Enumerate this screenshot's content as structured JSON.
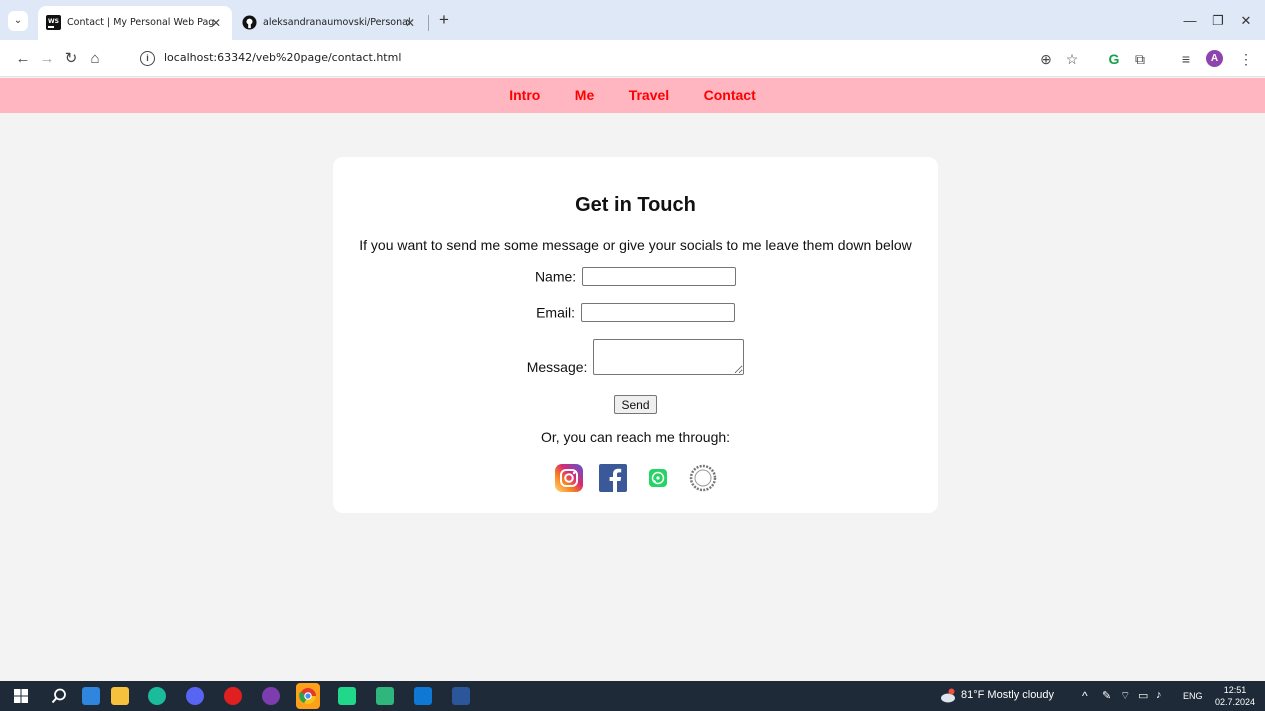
{
  "browser": {
    "tabs": [
      {
        "title": "Contact | My Personal Web Pag",
        "active": true
      },
      {
        "title": "aleksandranaumovski/Personal",
        "active": false
      }
    ],
    "tab_close": "✕",
    "new_tab": "+",
    "url": "localhost:63342/veb%20page/contact.html",
    "window_controls": {
      "minimize": "—",
      "restore": "❐",
      "close": "✕"
    },
    "profile_initial": "A"
  },
  "site_nav": {
    "items": [
      "Intro",
      "Me",
      "Travel",
      "Contact"
    ],
    "link_color": "#ff0000",
    "background": "#ffb6c1"
  },
  "contact": {
    "heading": "Get in Touch",
    "intro": "If you want to send me some message or give your socials to me leave them down below",
    "name_label": "Name:",
    "email_label": "Email:",
    "message_label": "Message:",
    "name_value": "",
    "email_value": "",
    "message_value": "",
    "send_label": "Send",
    "reach_text": "Or, you can reach me through:",
    "socials": [
      "instagram-icon",
      "facebook-icon",
      "whatsapp-icon",
      "threads-icon"
    ]
  },
  "taskbar": {
    "weather": "81°F  Mostly cloudy",
    "language": "ENG",
    "time": "12:51",
    "date": "02.7.2024"
  }
}
